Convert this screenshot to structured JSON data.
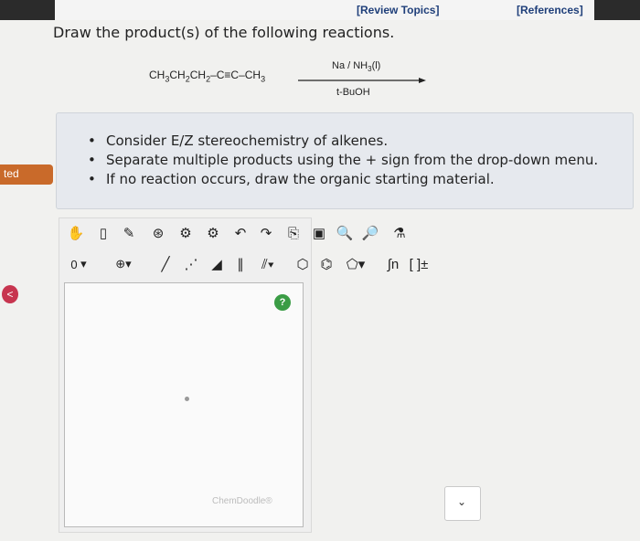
{
  "header": {
    "review_topics": "[Review Topics]",
    "references": "[References]"
  },
  "question": {
    "prompt": "Draw the product(s) of the following reactions."
  },
  "reaction": {
    "reactant_parts": [
      "CH",
      "3",
      "CH",
      "2",
      "CH",
      "2",
      "–C≡C–CH",
      "3"
    ],
    "reagent_above": [
      "Na / NH",
      "3",
      "(l)"
    ],
    "reagent_below": "t-BuOH"
  },
  "hints": [
    "Consider E/Z stereochemistry of alkenes.",
    "Separate multiple products using the + sign from the drop-down menu.",
    "If no reaction occurs, draw the organic starting material."
  ],
  "side_tab": {
    "label": "ted"
  },
  "back_button": {
    "icon": "chevron-left-icon"
  },
  "editor": {
    "toolbar_row1_icons": [
      "hand-icon",
      "eraser-icon",
      "pencil-icon",
      "ring-template-icon",
      "templates-icon",
      "undo-icon",
      "redo-icon",
      "copy-icon",
      "paste-icon",
      "zoom-in-icon",
      "zoom-out-icon",
      "clean-icon"
    ],
    "charge_value": "0",
    "help_label": "?",
    "watermark": "ChemDoodle®",
    "dropdown_symbol": "⌄"
  },
  "colors": {
    "accent_tab": "#c96a2a",
    "link": "#1f3f7a",
    "help": "#3a9c45",
    "back": "#c7354f"
  }
}
